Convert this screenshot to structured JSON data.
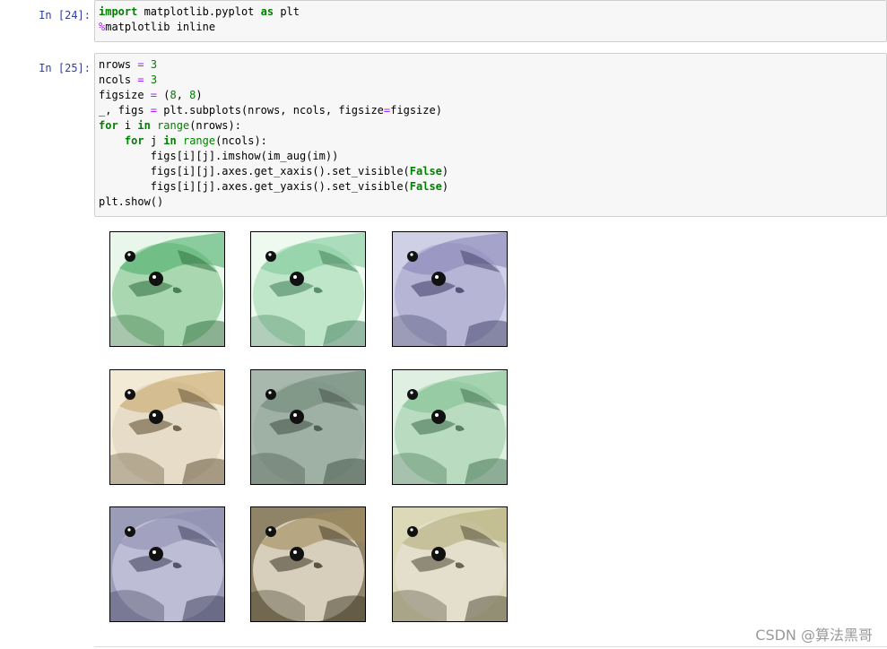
{
  "cells": [
    {
      "prompt": "In  [24]:",
      "lines": [
        [
          {
            "t": "import",
            "c": "kw"
          },
          {
            "t": " matplotlib.pyplot ",
            "c": ""
          },
          {
            "t": "as",
            "c": "kw"
          },
          {
            "t": " plt",
            "c": ""
          }
        ],
        [
          {
            "t": "%",
            "c": "mg"
          },
          {
            "t": "matplotlib inline",
            "c": ""
          }
        ]
      ]
    },
    {
      "prompt": "In  [25]:",
      "lines": [
        [
          {
            "t": "nrows ",
            "c": ""
          },
          {
            "t": "=",
            "c": "op"
          },
          {
            "t": " ",
            "c": ""
          },
          {
            "t": "3",
            "c": "num"
          }
        ],
        [
          {
            "t": "ncols ",
            "c": ""
          },
          {
            "t": "=",
            "c": "op"
          },
          {
            "t": " ",
            "c": ""
          },
          {
            "t": "3",
            "c": "num"
          }
        ],
        [
          {
            "t": "figsize ",
            "c": ""
          },
          {
            "t": "=",
            "c": "op"
          },
          {
            "t": " (",
            "c": ""
          },
          {
            "t": "8",
            "c": "num"
          },
          {
            "t": ", ",
            "c": ""
          },
          {
            "t": "8",
            "c": "num"
          },
          {
            "t": ")",
            "c": ""
          }
        ],
        [
          {
            "t": "_, figs ",
            "c": ""
          },
          {
            "t": "=",
            "c": "op"
          },
          {
            "t": " plt.subplots(nrows, ncols, figsize",
            "c": ""
          },
          {
            "t": "=",
            "c": "op"
          },
          {
            "t": "figsize)",
            "c": ""
          }
        ],
        [
          {
            "t": "for",
            "c": "kw"
          },
          {
            "t": " i ",
            "c": ""
          },
          {
            "t": "in",
            "c": "kw"
          },
          {
            "t": " ",
            "c": ""
          },
          {
            "t": "range",
            "c": "bi"
          },
          {
            "t": "(nrows):",
            "c": ""
          }
        ],
        [
          {
            "t": "    ",
            "c": ""
          },
          {
            "t": "for",
            "c": "kw"
          },
          {
            "t": " j ",
            "c": ""
          },
          {
            "t": "in",
            "c": "kw"
          },
          {
            "t": " ",
            "c": ""
          },
          {
            "t": "range",
            "c": "bi"
          },
          {
            "t": "(ncols):",
            "c": ""
          }
        ],
        [
          {
            "t": "        figs[i][j].imshow(im_aug(im))",
            "c": ""
          }
        ],
        [
          {
            "t": "        figs[i][j].axes.get_xaxis().set_visible(",
            "c": ""
          },
          {
            "t": "False",
            "c": "kc"
          },
          {
            "t": ")",
            "c": ""
          }
        ],
        [
          {
            "t": "        figs[i][j].axes.get_yaxis().set_visible(",
            "c": ""
          },
          {
            "t": "False",
            "c": "kc"
          },
          {
            "t": ")",
            "c": ""
          }
        ],
        [
          {
            "t": "plt.show()",
            "c": ""
          }
        ]
      ]
    }
  ],
  "output": {
    "subplots": [
      {
        "tint": "#4caf6a",
        "bg": "#e9f7ea",
        "shade": "#2e6b3a",
        "fur": "#a9d8b0"
      },
      {
        "tint": "#7fc99a",
        "bg": "#eefaf0",
        "shade": "#3c7a55",
        "fur": "#bfe6c9"
      },
      {
        "tint": "#8a86b8",
        "bg": "#cfd0e6",
        "shade": "#3d3b63",
        "fur": "#b6b5d6"
      },
      {
        "tint": "#c8a86c",
        "bg": "#f3ead6",
        "shade": "#5a4a2e",
        "fur": "#e6dcc8"
      },
      {
        "tint": "#6f8a78",
        "bg": "#a9b8ad",
        "shade": "#3e4e44",
        "fur": "#9fb0a4"
      },
      {
        "tint": "#7fbf8f",
        "bg": "#dff0e2",
        "shade": "#3d6a4a",
        "fur": "#b9dcc0"
      },
      {
        "tint": "#8f8fb2",
        "bg": "#9b9cb8",
        "shade": "#3a3a55",
        "fur": "#bdbdd5"
      },
      {
        "tint": "#a08a5c",
        "bg": "#8f8468",
        "shade": "#3a3322",
        "fur": "#d7cfbb"
      },
      {
        "tint": "#b3ad78",
        "bg": "#dcd9b8",
        "shade": "#4a4630",
        "fur": "#e3dfcc"
      }
    ]
  },
  "watermark": "CSDN @算法黑哥"
}
